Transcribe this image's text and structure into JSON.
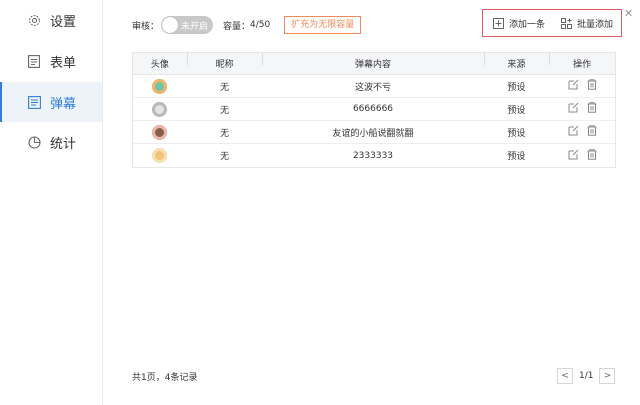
{
  "sidebar": {
    "items": [
      {
        "label": "设置",
        "icon": "gear-icon",
        "active": false
      },
      {
        "label": "表单",
        "icon": "form-icon",
        "active": false
      },
      {
        "label": "弹幕",
        "icon": "danmaku-icon",
        "active": true
      },
      {
        "label": "统计",
        "icon": "pie-chart-icon",
        "active": false
      }
    ]
  },
  "toolbar": {
    "review_label": "审核：",
    "toggle_text": "未开启",
    "capacity_label": "容量：",
    "capacity_value": "4/50",
    "expand_label": "扩充为无限容量",
    "add_one_label": "添加一条",
    "batch_add_label": "批量添加"
  },
  "table": {
    "headers": [
      "头像",
      "昵称",
      "弹幕内容",
      "来源",
      "操作"
    ],
    "rows": [
      {
        "nickname": "无",
        "content": "这波不亏",
        "source": "预设",
        "avatar_color": "#6cc5a8"
      },
      {
        "nickname": "无",
        "content": "6666666",
        "source": "预设",
        "avatar_color": "#d9d9d9"
      },
      {
        "nickname": "无",
        "content": "友谊的小船说翻就翻",
        "source": "预设",
        "avatar_color": "#8a5a4a"
      },
      {
        "nickname": "无",
        "content": "2333333",
        "source": "预设",
        "avatar_color": "#f0c27a"
      }
    ]
  },
  "footer": {
    "summary": "共1页，4条记录",
    "page": "1/1"
  },
  "colors": {
    "accent": "#2f7fd6",
    "warn": "#f08a5d",
    "highlight_border": "#e05a5a"
  }
}
